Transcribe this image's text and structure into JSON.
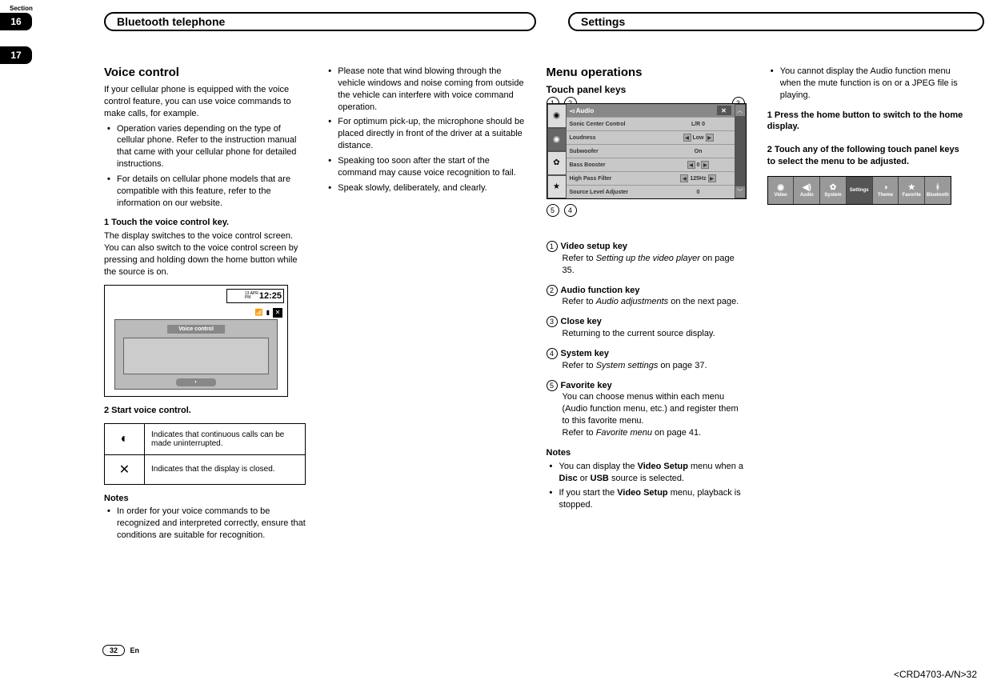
{
  "section_label": "Section",
  "tabs": {
    "t16": "16",
    "t17": "17"
  },
  "headers": {
    "left": "Bluetooth telephone",
    "right": "Settings"
  },
  "col1": {
    "h2": "Voice control",
    "intro": "If your cellular phone is equipped with the voice control feature, you can use voice commands to make calls, for example.",
    "b1": "Operation varies depending on the type of cellular phone. Refer to the instruction manual that came with your cellular phone for detailed instructions.",
    "b2": "For details on cellular phone models that are compatible with this feature, refer to the information on our website.",
    "step1_hd": "1    Touch the voice control key.",
    "step1_p": "The display switches to the voice control screen. You can also switch to the voice control screen by pressing and holding down the home button while the source is on.",
    "vc_time_a": "13 APR",
    "vc_time_b": "PM",
    "vc_time_c": "12:25",
    "vc_label": "Voice control",
    "step2_hd": "2    Start voice control.",
    "tbl_r1": "Indicates that continuous calls can be made uninterrupted.",
    "tbl_r2": "Indicates that the display is closed.",
    "notes_hd": "Notes",
    "n1": "In order for your voice commands to be recognized and interpreted correctly, ensure that conditions are suitable for recognition."
  },
  "col2": {
    "b1": "Please note that wind blowing through the vehicle windows and noise coming from outside the vehicle can interfere with voice command operation.",
    "b2": "For optimum pick-up, the microphone should be placed directly in front of the driver at a suitable distance.",
    "b3": "Speaking too soon after the start of the command may cause voice recognition to fail.",
    "b4": "Speak slowly, deliberately, and clearly."
  },
  "col3": {
    "h2": "Menu operations",
    "h3": "Touch panel keys",
    "panel": {
      "title": "Audio",
      "rows": [
        {
          "label": "Sonic Center Control",
          "value": "L/R  0",
          "arrows": false
        },
        {
          "label": "Loudness",
          "value": "Low",
          "arrows": true
        },
        {
          "label": "Subwoofer",
          "value": "On",
          "arrows": false
        },
        {
          "label": "Bass Booster",
          "value": "0",
          "arrows": true
        },
        {
          "label": "High Pass Filter",
          "value": "125Hz",
          "arrows": true
        },
        {
          "label": "Source Level Adjuster",
          "value": "0",
          "arrows": false
        }
      ]
    },
    "keys": [
      {
        "num": "1",
        "name": "Video setup key",
        "desc_a": "Refer to ",
        "desc_em": "Setting up the video player",
        "desc_b": " on page 35."
      },
      {
        "num": "2",
        "name": "Audio function key",
        "desc_a": "Refer to ",
        "desc_em": "Audio adjustments",
        "desc_b": " on the next page."
      },
      {
        "num": "3",
        "name": "Close key",
        "desc_a": "Returning to the current source display.",
        "desc_em": "",
        "desc_b": ""
      },
      {
        "num": "4",
        "name": "System key",
        "desc_a": "Refer to ",
        "desc_em": "System settings",
        "desc_b": " on page 37."
      },
      {
        "num": "5",
        "name": "Favorite key",
        "desc_a": "You can choose menus within each menu (Audio function menu, etc.) and register them to this favorite menu.\nRefer to ",
        "desc_em": "Favorite menu",
        "desc_b": " on page 41."
      }
    ],
    "notes_hd": "Notes",
    "nb1_a": "You can display the ",
    "nb1_b": "Video Setup",
    "nb1_c": " menu when a ",
    "nb1_d": "Disc",
    "nb1_e": " or ",
    "nb1_f": "USB",
    "nb1_g": " source is selected.",
    "nb2_a": "If you start the ",
    "nb2_b": "Video Setup",
    "nb2_c": " menu, playback is stopped."
  },
  "col4": {
    "b1": "You cannot display the Audio function menu when the mute function is on or a JPEG file is playing.",
    "step1": "1    Press the home button to switch to the home display.",
    "step2": "2    Touch any of the following touch panel keys to select the menu to be adjusted.",
    "bar": [
      "Video",
      "Audio",
      "System",
      "Settings",
      "Theme",
      "Favorite",
      "Bluetooth"
    ],
    "bar_icons": [
      "◉",
      "◀)",
      "✿",
      "",
      "◑",
      "★",
      "ᚼ"
    ]
  },
  "footer": {
    "page": "32",
    "lang": "En",
    "docref": "<CRD4703-A/N>32"
  },
  "callout_nums": {
    "c1": "1",
    "c2": "2",
    "c3": "3",
    "c4": "4",
    "c5": "5"
  }
}
